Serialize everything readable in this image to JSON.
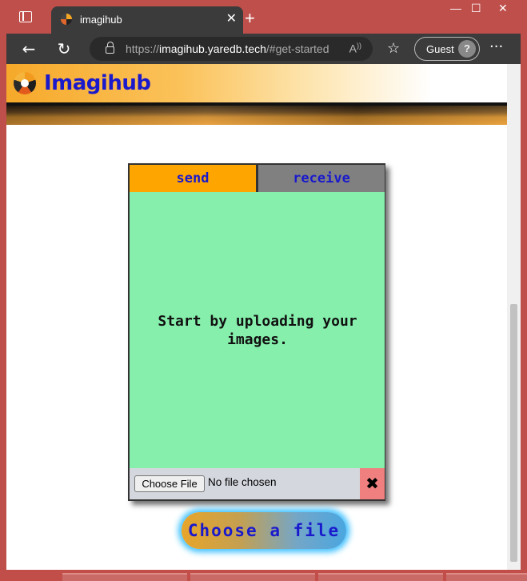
{
  "browser": {
    "tab_title": "imagihub",
    "new_tab_symbol": "+",
    "close_symbol": "✕",
    "url_scheme": "https://",
    "url_host": "imagihub.yaredb.tech",
    "url_path": "/#get-started",
    "read_aloud_symbol": "Aͅ",
    "profile_label": "Guest",
    "more_symbol": "···",
    "window_controls": {
      "minimize": "—",
      "maximize": "☐",
      "close": "✕"
    }
  },
  "site": {
    "title": "Imagihub",
    "brand_color": "#1a1acc"
  },
  "card": {
    "tabs": [
      {
        "label": "send",
        "active": true,
        "color": "#ffa500"
      },
      {
        "label": "receive",
        "active": false,
        "color": "#808080"
      }
    ],
    "message": "Start by uploading your images.",
    "drop_color": "#86efac",
    "file_input": {
      "button_label": "Choose File",
      "status": "No file chosen"
    },
    "clear_symbol": "✖"
  },
  "cta": {
    "label": "Choose a file"
  }
}
